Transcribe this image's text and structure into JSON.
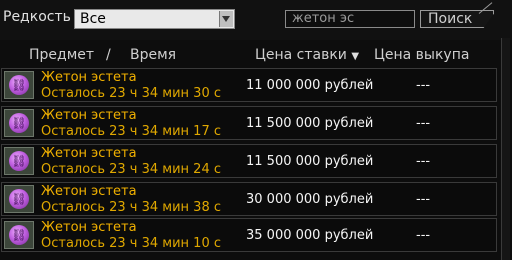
{
  "filters": {
    "rarity_label": "Редкость",
    "rarity_value": "Все",
    "search_value": "жетон эс",
    "search_button": "Поиск"
  },
  "columns": {
    "item": "Предмет",
    "separator": "/",
    "time": "Время",
    "bid": "Цена ставки",
    "buyout": "Цена выкупа"
  },
  "rows": [
    {
      "name": "Жетон эстета",
      "time": "Осталось 23 ч 34 мин 30 с",
      "bid": "11 000 000 рублей",
      "buyout": "---"
    },
    {
      "name": "Жетон эстета",
      "time": "Осталось 23 ч 34 мин 17 с",
      "bid": "11 500 000 рублей",
      "buyout": "---"
    },
    {
      "name": "Жетон эстета",
      "time": "Осталось 23 ч 34 мин 24 с",
      "bid": "11 500 000 рублей",
      "buyout": "---"
    },
    {
      "name": "Жетон эстета",
      "time": "Осталось 23 ч 34 мин 38 с",
      "bid": "30 000 000 рублей",
      "buyout": "---"
    },
    {
      "name": "Жетон эстета",
      "time": "Осталось 23 ч 34 мин 10 с",
      "bid": "35 000 000 рублей",
      "buyout": "---"
    }
  ],
  "icons": {
    "item_icon": "aesthete-token-icon",
    "sort_icon": "sort-down-icon",
    "dropdown_icon": "chevron-down-icon"
  }
}
